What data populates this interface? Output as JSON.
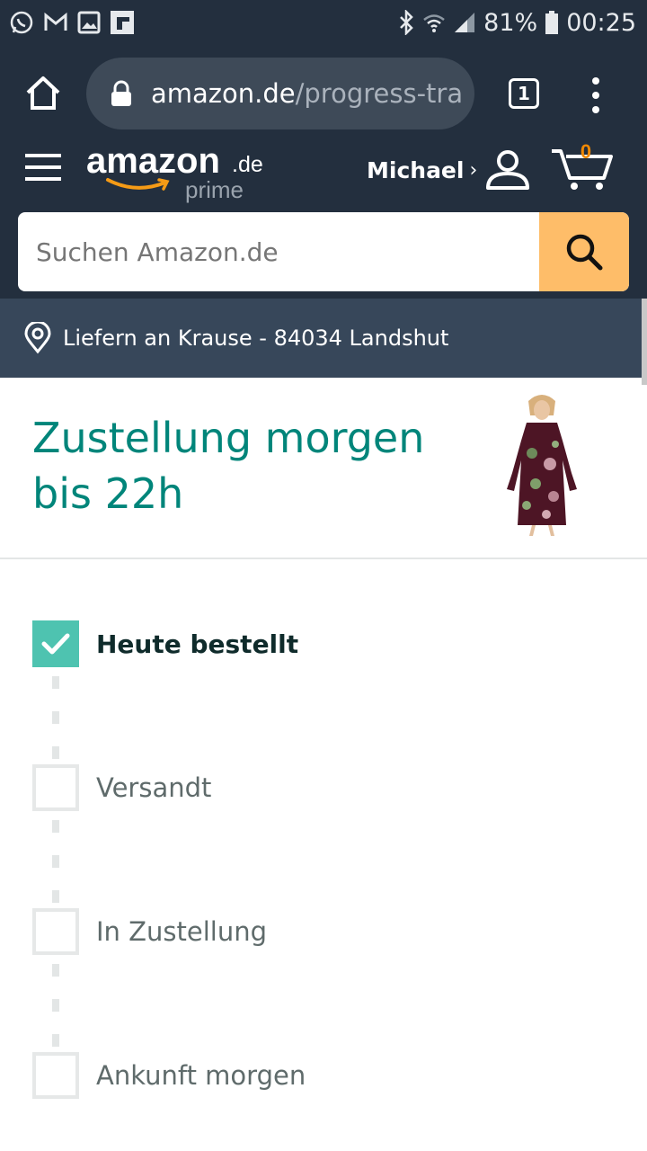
{
  "status_bar": {
    "battery": "81%",
    "time": "00:25",
    "icons": [
      "whatsapp-icon",
      "gmail-icon",
      "gallery-icon",
      "flipboard-icon",
      "bluetooth-icon",
      "wifi-icon",
      "signal-icon",
      "battery-icon"
    ]
  },
  "browser": {
    "url_host": "amazon.de",
    "url_path": "/progress-tra",
    "tab_count": "1"
  },
  "header": {
    "logo_text": "amazon",
    "logo_suffix": ".de",
    "logo_prime": "prime",
    "account_name": "Michael",
    "account_chevron": "›",
    "cart_count": "0",
    "colors": {
      "bar": "#232f3e",
      "accent": "#febd69",
      "cart_count": "#f08804"
    }
  },
  "search": {
    "placeholder": "Suchen Amazon.de"
  },
  "deliver_to": {
    "text": "Liefern an Krause - 84034 Landshut"
  },
  "delivery": {
    "headline_line1": "Zustellung morgen",
    "headline_line2": "bis 22h",
    "headline_color": "#00857a"
  },
  "steps": [
    {
      "label": "Heute bestellt",
      "completed": true
    },
    {
      "label": "Versandt",
      "completed": false
    },
    {
      "label": "In Zustellung",
      "completed": false
    },
    {
      "label": "Ankunft morgen",
      "completed": false
    }
  ]
}
